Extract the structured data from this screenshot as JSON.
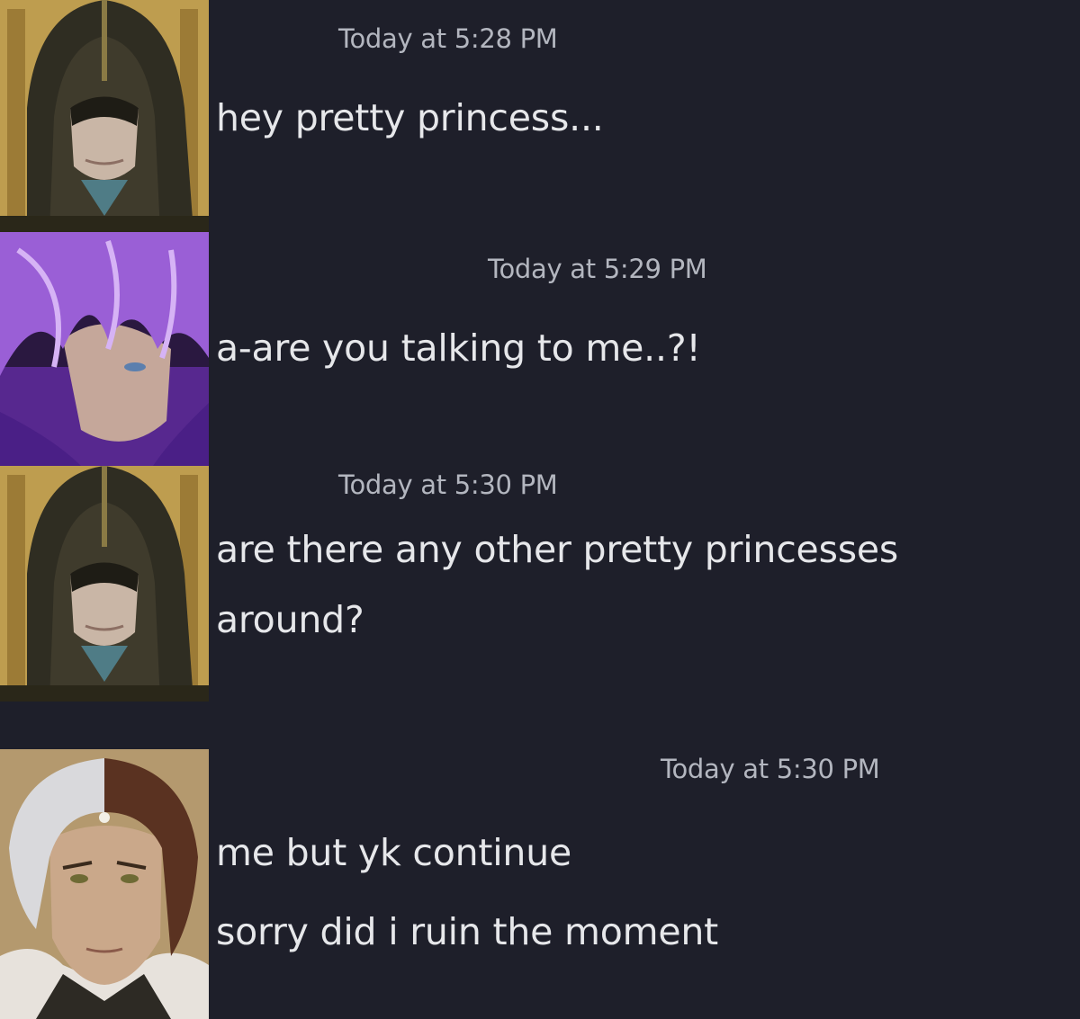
{
  "messages": [
    {
      "timestamp": "Today at 5:28 PM",
      "lines": [
        "hey pretty princess..."
      ]
    },
    {
      "timestamp": "Today at 5:29 PM",
      "lines": [
        "a-are you talking to me..?!"
      ]
    },
    {
      "timestamp": "Today at 5:30 PM",
      "lines": [
        "are there any other pretty princesses",
        "around?"
      ]
    },
    {
      "timestamp": "Today at 5:30 PM",
      "lines": [
        "me but yk continue",
        "sorry did i ruin the moment"
      ]
    }
  ],
  "avatars": [
    {
      "icon": "hooded-figure-avatar",
      "accent": "#c9a94a"
    },
    {
      "icon": "purple-haired-man-avatar",
      "accent": "#8a3fd1"
    },
    {
      "icon": "hooded-figure-avatar",
      "accent": "#c9a94a"
    },
    {
      "icon": "two-tone-haired-man-avatar",
      "accent": "#b79a6a"
    }
  ],
  "colors": {
    "background": "#1e1f2a",
    "text": "#e6e7ea",
    "timestamp": "#b3b6bf"
  }
}
